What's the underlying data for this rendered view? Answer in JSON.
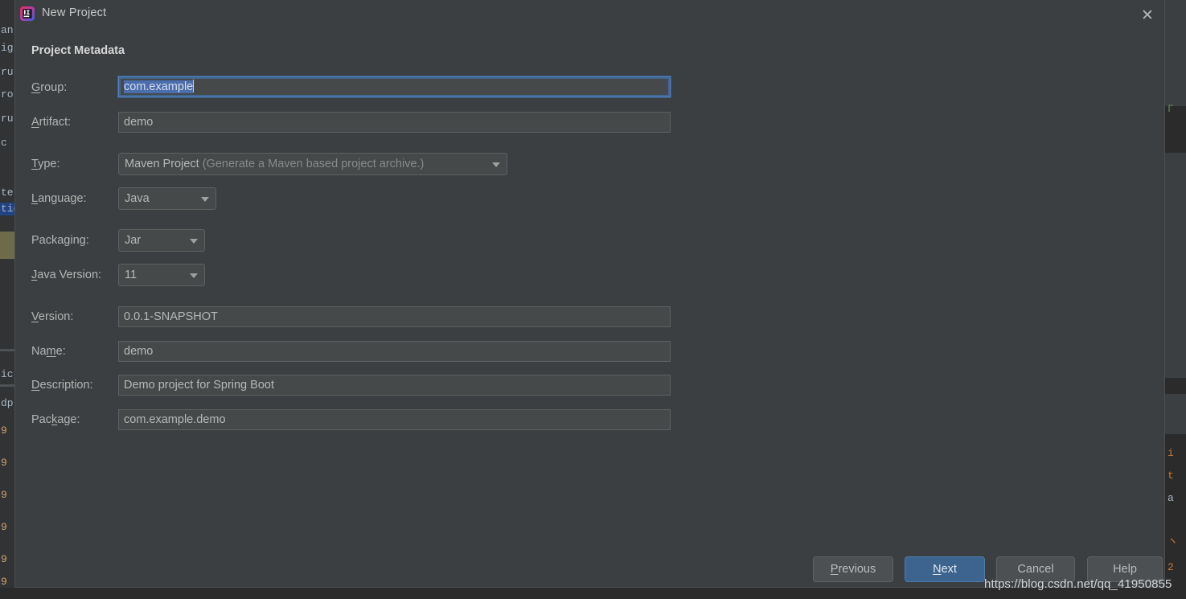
{
  "window": {
    "title": "New Project",
    "icon": "intellij-idea-icon",
    "close_label": "✕"
  },
  "dialog": {
    "section_title": "Project Metadata"
  },
  "fields": {
    "group": {
      "label": "Group:",
      "mnemonic": "G",
      "value": "com.example",
      "focused": true,
      "selected": true
    },
    "artifact": {
      "label": "Artifact:",
      "mnemonic": "A",
      "value": "demo"
    },
    "type": {
      "label": "Type:",
      "mnemonic": "T",
      "value": "Maven Project",
      "hint": "(Generate a Maven based project archive.)"
    },
    "language": {
      "label": "Language:",
      "mnemonic": "L",
      "value": "Java"
    },
    "packaging": {
      "label": "Packaging:",
      "mnemonic": "",
      "value": "Jar"
    },
    "java_version": {
      "label": "Java Version:",
      "mnemonic": "J",
      "value": "11"
    },
    "version": {
      "label": "Version:",
      "mnemonic": "V",
      "value": "0.0.1-SNAPSHOT"
    },
    "name": {
      "label": "Name:",
      "mnemonic": "m",
      "value": "demo"
    },
    "description": {
      "label": "Description:",
      "mnemonic": "D",
      "value": "Demo project for Spring Boot"
    },
    "package": {
      "label": "Package:",
      "mnemonic": "k",
      "value": "com.example.demo"
    }
  },
  "buttons": {
    "previous": "Previous",
    "next": "Next",
    "cancel": "Cancel",
    "help": "Help"
  },
  "watermark": {
    "text": "https://blog.csdn.net/qq_41950855"
  },
  "background": {
    "left_fragments": [
      "an",
      "ig",
      "ru",
      "ro",
      "ru",
      "c",
      "te",
      "tic",
      "",
      "",
      "",
      "ic",
      "dp",
      "9",
      "9",
      "9",
      "9",
      "9",
      "9"
    ],
    "right_fragments": [
      "Γ",
      "i",
      "t",
      "a",
      "ヽ",
      "2"
    ]
  },
  "colors": {
    "dialog_bg": "#3c3f41",
    "field_bg": "#45494a",
    "accent_blue": "#3c648f",
    "selection_blue": "#4b6eaf",
    "focus_border": "#4d7fc4",
    "text": "#b4b4b4"
  }
}
